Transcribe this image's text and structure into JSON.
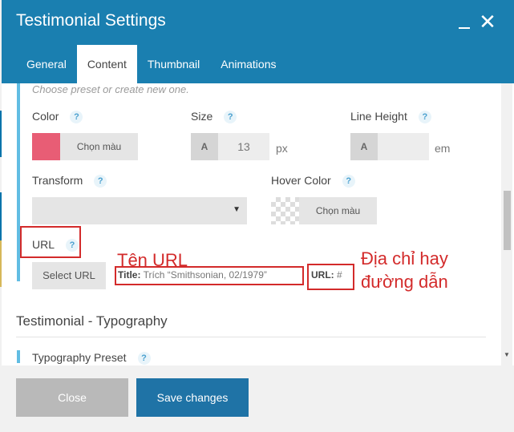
{
  "dialog": {
    "title": "Testimonial Settings",
    "close_icon": "close-icon",
    "minimize_icon": "minimize-icon"
  },
  "tabs": [
    {
      "label": "General",
      "active": false
    },
    {
      "label": "Content",
      "active": true
    },
    {
      "label": "Thumbnail",
      "active": false
    },
    {
      "label": "Animations",
      "active": false
    }
  ],
  "content": {
    "preset_hint": "Choose preset or create new one.",
    "help_glyph": "?",
    "color": {
      "label": "Color",
      "swatch": "#e85d75",
      "button": "Chọn màu"
    },
    "size": {
      "label": "Size",
      "prefix": "A",
      "value": "13",
      "unit": "px"
    },
    "line_height": {
      "label": "Line Height",
      "prefix": "A",
      "value": "",
      "unit": "em"
    },
    "transform": {
      "label": "Transform",
      "value": "",
      "caret": "▼"
    },
    "hover_color": {
      "label": "Hover Color",
      "button": "Chọn màu"
    },
    "url": {
      "label": "URL",
      "select_button": "Select URL",
      "title_label": "Title:",
      "title_value": "Trích “Smithsonian, 02/1979”",
      "url_label": "URL:",
      "url_value": "#"
    },
    "typography_section": "Testimonial - Typography",
    "typography_preset": "Typography Preset"
  },
  "annotations": {
    "url_name": "Tên URL",
    "address_line1": "Địa chỉ hay",
    "address_line2": "đường dẫn",
    "color": "#d32b2b"
  },
  "footer": {
    "close": "Close",
    "save": "Save changes"
  },
  "colors": {
    "header": "#1a7fb0",
    "accent": "#61bde3",
    "save": "#1f73a6"
  }
}
